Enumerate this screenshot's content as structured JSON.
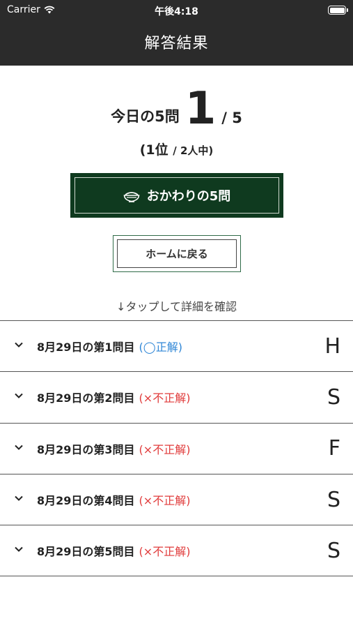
{
  "status": {
    "carrier": "Carrier",
    "time": "午後4:18"
  },
  "header": {
    "title": "解答結果"
  },
  "score": {
    "label": "今日の5問",
    "correct": "1",
    "total": "/ 5"
  },
  "rank": {
    "text": "(1位",
    "detail": "/ 2人中)"
  },
  "buttons": {
    "more": "おかわりの5問",
    "home": "ホームに戻る"
  },
  "hint": "↓タップして詳細を確認",
  "questions": [
    {
      "title": "8月29日の第1問目",
      "result": "(◯正解)",
      "correct": true,
      "grade": "H"
    },
    {
      "title": "8月29日の第2問目",
      "result": "(×不正解)",
      "correct": false,
      "grade": "S"
    },
    {
      "title": "8月29日の第3問目",
      "result": "(×不正解)",
      "correct": false,
      "grade": "F"
    },
    {
      "title": "8月29日の第4問目",
      "result": "(×不正解)",
      "correct": false,
      "grade": "S"
    },
    {
      "title": "8月29日の第5問目",
      "result": "(×不正解)",
      "correct": false,
      "grade": "S"
    }
  ],
  "colors": {
    "header_bg": "#2b2b2b",
    "primary_button": "#0f3a1f",
    "correct": "#2f86d6",
    "incorrect": "#e03a3a"
  }
}
